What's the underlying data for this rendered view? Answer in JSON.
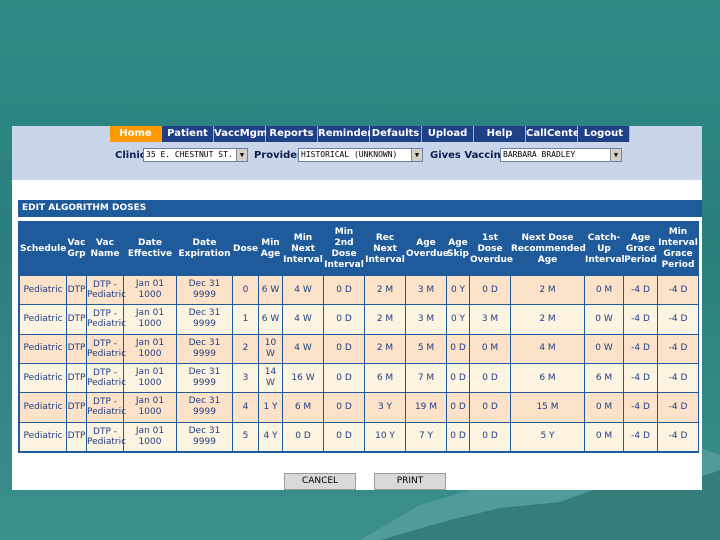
{
  "nav": {
    "tabs": [
      "Home",
      "Patient",
      "VaccMgmt",
      "Reports",
      "Reminder",
      "Defaults",
      "Upload",
      "Help",
      "CallCenter",
      "Logout"
    ],
    "active": "Home"
  },
  "filters": {
    "clinic_label": "Clinic",
    "clinic_value": "35 E. CHESTNUT ST.",
    "provider_label": "Provider",
    "provider_value": "HISTORICAL (UNKNOWN)",
    "vaccine_label": "Gives Vaccine",
    "vaccine_value": "BARBARA BRADLEY"
  },
  "section_title": "EDIT ALGORITHM DOSES",
  "table": {
    "columns": [
      "Schedule",
      "Vac Grp",
      "Vac Name",
      "Date Effective",
      "Date Expiration",
      "Dose",
      "Min Age",
      "Min Next Interval",
      "Min 2nd Dose Interval",
      "Rec Next Interval",
      "Age Overdue",
      "Age Skip",
      "1st Dose Overdue",
      "Next Dose Recommended Age",
      "Catch-Up Interval",
      "Age Grace Period",
      "Min Interval Grace Period"
    ],
    "rows": [
      [
        "Pediatric",
        "DTP",
        "DTP - Pediatric",
        "Jan 01 1000",
        "Dec 31 9999",
        "0",
        "6 W",
        "4 W",
        "0 D",
        "2 M",
        "3 M",
        "0 Y",
        "0 D",
        "2 M",
        "0 M",
        "-4 D",
        "-4 D"
      ],
      [
        "Pediatric",
        "DTP",
        "DTP - Pediatric",
        "Jan 01 1000",
        "Dec 31 9999",
        "1",
        "6 W",
        "4 W",
        "0 D",
        "2 M",
        "3 M",
        "0 Y",
        "3 M",
        "2 M",
        "0 W",
        "-4 D",
        "-4 D"
      ],
      [
        "Pediatric",
        "DTP",
        "DTP - Pediatric",
        "Jan 01 1000",
        "Dec 31 9999",
        "2",
        "10 W",
        "4 W",
        "0 D",
        "2 M",
        "5 M",
        "0 D",
        "0 M",
        "4 M",
        "0 W",
        "-4 D",
        "-4 D"
      ],
      [
        "Pediatric",
        "DTP",
        "DTP - Pediatric",
        "Jan 01 1000",
        "Dec 31 9999",
        "3",
        "14 W",
        "16 W",
        "0 D",
        "6 M",
        "7 M",
        "0 D",
        "0 D",
        "6 M",
        "6 M",
        "-4 D",
        "-4 D"
      ],
      [
        "Pediatric",
        "DTP",
        "DTP - Pediatric",
        "Jan 01 1000",
        "Dec 31 9999",
        "4",
        "1 Y",
        "6 M",
        "0 D",
        "3 Y",
        "19 M",
        "0 D",
        "0 D",
        "15 M",
        "0 M",
        "-4 D",
        "-4 D"
      ],
      [
        "Pediatric",
        "DTP",
        "DTP - Pediatric",
        "Jan 01 1000",
        "Dec 31 9999",
        "5",
        "4 Y",
        "0 D",
        "0 D",
        "10 Y",
        "7 Y",
        "0 D",
        "0 D",
        "5 Y",
        "0 M",
        "-4 D",
        "-4 D"
      ]
    ]
  },
  "buttons": {
    "cancel": "CANCEL",
    "print": "PRINT"
  },
  "colors": {
    "nav_bg": "#1f3f86",
    "nav_active": "#ff9900",
    "header_bg": "#1f5b9b",
    "row_odd": "#fbe2c8",
    "row_even": "#fdf3e1"
  }
}
